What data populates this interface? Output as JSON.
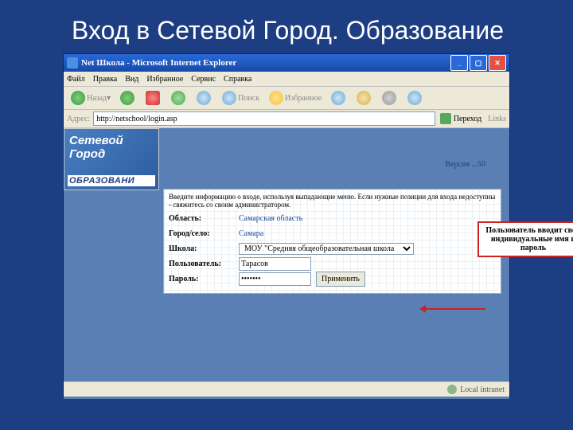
{
  "slide_title_prefix": "Вход в ",
  "slide_title_accent": "Сетевой Город. Образование",
  "window": {
    "title": "Net Школа - Microsoft Internet Explorer"
  },
  "menu": {
    "file": "Файл",
    "edit": "Правка",
    "view": "Вид",
    "fav": "Избранное",
    "tools": "Сервис",
    "help": "Справка"
  },
  "toolbar": {
    "back": "Назад",
    "search": "Поиск",
    "favorites": "Избранное"
  },
  "address": {
    "label": "Адрес:",
    "value": "http://netschool/login.asp",
    "go": "Переход",
    "links": "Links"
  },
  "logo": {
    "line1": "Сетевой",
    "line2": "Город",
    "edu": "ОБРАЗОВАНИ"
  },
  "version": "Версия ...50",
  "form": {
    "hint": "Введите информацию о входе, используя выпадающие меню. Если нужные позиции для входа недоступны - свяжитесь со своим администратором.",
    "region_label": "Область:",
    "region_value": "Самарская область",
    "city_label": "Город/село:",
    "city_value": "Самара",
    "school_label": "Школа:",
    "school_value": "МОУ \"Средняя общеобразовательная школа",
    "user_label": "Пользователь:",
    "user_value": "Тарасов",
    "pass_label": "Пароль:",
    "pass_value": "•••••••",
    "submit": "Применить"
  },
  "callout": "Пользователь вводит свои индивидуальные имя и пароль",
  "status": {
    "zone": "Local intranet"
  }
}
